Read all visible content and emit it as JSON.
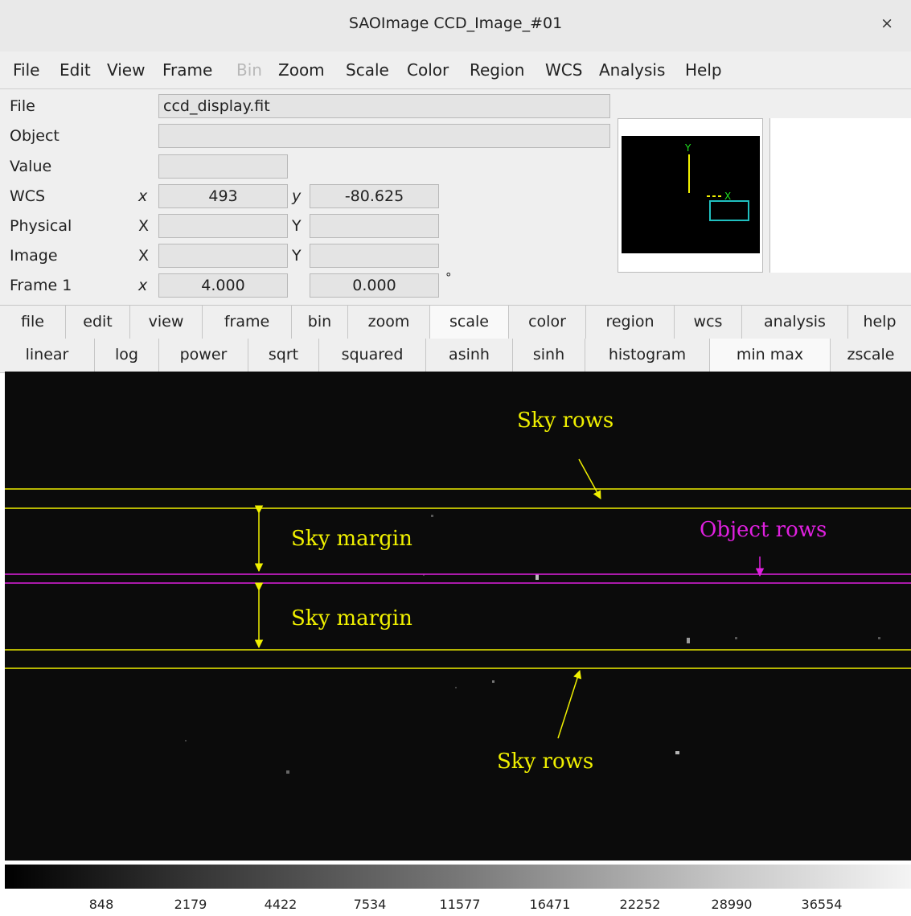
{
  "window": {
    "title": "SAOImage CCD_Image_#01",
    "close_glyph": "×"
  },
  "menu": [
    "File",
    "Edit",
    "View",
    "Frame",
    "Bin",
    "Zoom",
    "Scale",
    "Color",
    "Region",
    "WCS",
    "Analysis",
    "Help"
  ],
  "menu_disabled": [
    "Bin"
  ],
  "info": {
    "file_label": "File",
    "file_value": "ccd_display.fit",
    "object_label": "Object",
    "object_value": "",
    "value_label": "Value",
    "value_value": "",
    "wcs_label": "WCS",
    "wcs_x_label": "x",
    "wcs_x": "493",
    "wcs_y_label": "y",
    "wcs_y": "-80.625",
    "physical_label": "Physical",
    "physical_x_label": "X",
    "physical_y_label": "Y",
    "image_label": "Image",
    "image_x_label": "X",
    "image_y_label": "Y",
    "frame_label": "Frame 1",
    "frame_x_label": "x",
    "frame_zoom": "4.000",
    "frame_angle": "0.000",
    "angle_unit": "°"
  },
  "panner": {
    "y_label": "Y",
    "x_label": "X"
  },
  "buttons_main": [
    "file",
    "edit",
    "view",
    "frame",
    "bin",
    "zoom",
    "scale",
    "color",
    "region",
    "wcs",
    "analysis",
    "help"
  ],
  "buttons_main_selected": "scale",
  "buttons_scale": [
    "linear",
    "log",
    "power",
    "sqrt",
    "squared",
    "asinh",
    "sinh",
    "histogram",
    "min max",
    "zscale"
  ],
  "annotations": {
    "sky_rows_top": "Sky rows",
    "sky_margin_top": "Sky margin",
    "object_rows": "Object rows",
    "sky_margin_bottom": "Sky margin",
    "sky_rows_bottom": "Sky rows"
  },
  "colors": {
    "sky": "#f0f000",
    "object": "#e020e0",
    "region_box": "#20c0c0",
    "panner_green": "#20e020"
  },
  "colorbar_ticks": [
    "848",
    "2179",
    "4422",
    "7534",
    "11577",
    "16471",
    "22252",
    "28990",
    "36554"
  ]
}
